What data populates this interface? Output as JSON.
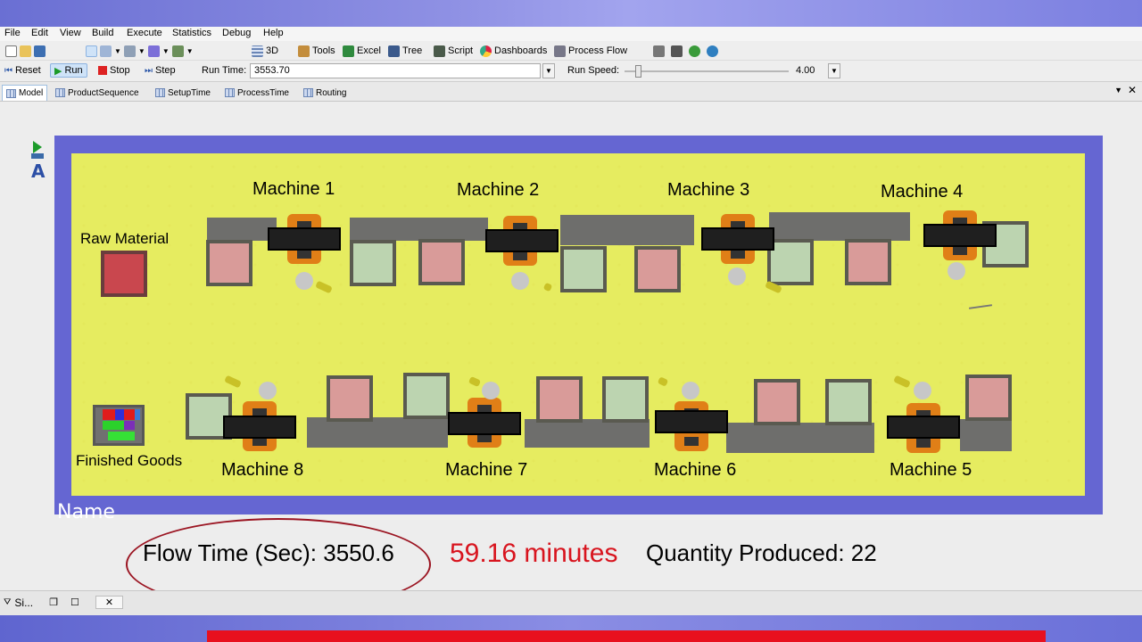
{
  "menu": [
    "File",
    "Edit",
    "View",
    "Build",
    "Execute",
    "Statistics",
    "Debug",
    "Help"
  ],
  "toolbar": {
    "3d": "3D",
    "tools": "Tools",
    "excel": "Excel",
    "tree": "Tree",
    "script": "Script",
    "dashboards": "Dashboards",
    "process_flow": "Process Flow"
  },
  "run_controls": {
    "reset": "Reset",
    "run": "Run",
    "stop": "Stop",
    "step": "Step",
    "run_time_label": "Run Time:",
    "run_time_value": "3553.70",
    "run_speed_label": "Run Speed:",
    "run_speed_value": "4.00"
  },
  "tabs": [
    "Model",
    "ProductSequence",
    "SetupTime",
    "ProcessTime",
    "Routing"
  ],
  "model": {
    "raw_material": "Raw Material",
    "finished_goods": "Finished Goods",
    "machines": [
      "Machine 1",
      "Machine 2",
      "Machine 3",
      "Machine 4",
      "Machine 5",
      "Machine 6",
      "Machine 7",
      "Machine 8"
    ],
    "name_label": "Name"
  },
  "stats": {
    "flow_time": "Flow Time (Sec): 3550.6",
    "minutes": "59.16 minutes",
    "quantity": "Quantity Produced: 22"
  },
  "doc_tab": "Si...",
  "colors": {
    "floor_border": "#6566d2",
    "accent_red": "#e8101e",
    "minutes_red": "#d8141e",
    "machine_orange": "#e07f17"
  }
}
